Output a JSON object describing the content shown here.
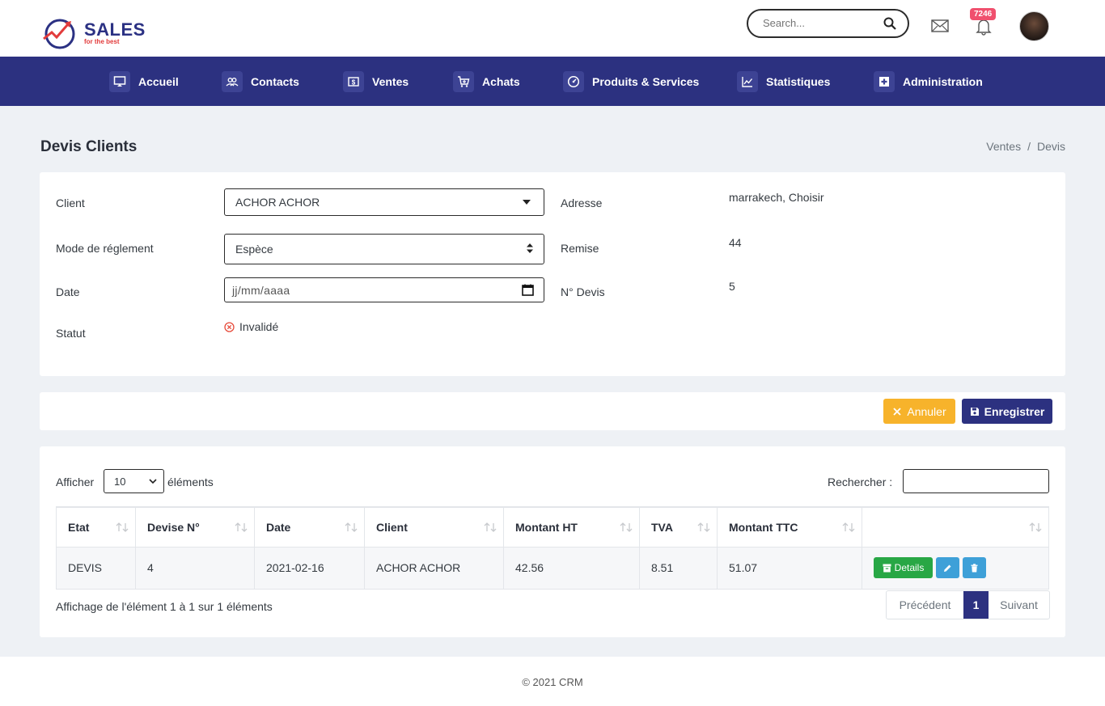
{
  "header": {
    "logo_text": "SALES",
    "logo_tagline": "for the best",
    "search_placeholder": "Search...",
    "notification_count": "7246"
  },
  "nav": [
    {
      "label": "Accueil",
      "icon": "monitor-icon"
    },
    {
      "label": "Contacts",
      "icon": "users-icon"
    },
    {
      "label": "Ventes",
      "icon": "dollar-icon"
    },
    {
      "label": "Achats",
      "icon": "cart-icon"
    },
    {
      "label": "Produits & Services",
      "icon": "gauge-icon"
    },
    {
      "label": "Statistiques",
      "icon": "chart-icon"
    },
    {
      "label": "Administration",
      "icon": "plus-box-icon"
    }
  ],
  "page": {
    "title": "Devis Clients",
    "breadcrumb": [
      "Ventes",
      "Devis"
    ]
  },
  "form": {
    "client_label": "Client",
    "client_value": "ACHOR ACHOR",
    "mode_label": "Mode de réglement",
    "mode_value": "Espèce",
    "date_label": "Date",
    "date_placeholder": "jj/mm/aaaa",
    "statut_label": "Statut",
    "statut_value": "Invalidé",
    "adresse_label": "Adresse",
    "adresse_value": "marrakech, Choisir",
    "remise_label": "Remise",
    "remise_value": "44",
    "ndevis_label": "N° Devis",
    "ndevis_value": "5"
  },
  "actions": {
    "cancel_label": "Annuler",
    "save_label": "Enregistrer"
  },
  "table": {
    "show_label": "Afficher",
    "page_length": "10",
    "elements_label": "éléments",
    "search_label": "Rechercher :",
    "columns": [
      "Etat",
      "Devise N°",
      "Date",
      "Client",
      "Montant HT",
      "TVA",
      "Montant TTC",
      ""
    ],
    "rows": [
      [
        "DEVIS",
        "4",
        "2021-02-16",
        "ACHOR ACHOR",
        "42.56",
        "8.51",
        "51.07"
      ]
    ],
    "details_label": "Details",
    "info": "Affichage de l'élément 1 à 1 sur 1 éléments",
    "prev_label": "Précédent",
    "page_number": "1",
    "next_label": "Suivant"
  },
  "footer": {
    "text": "© 2021 CRM"
  },
  "colors": {
    "primary": "#2c3180",
    "warning": "#f7b32b",
    "success": "#28a745",
    "info": "#3ea0d8",
    "badge": "#f0506e"
  }
}
